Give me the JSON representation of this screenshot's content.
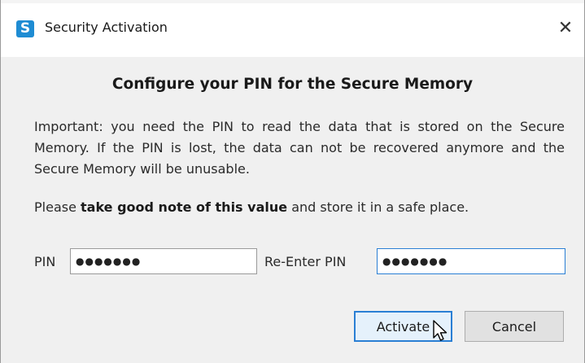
{
  "window": {
    "title": "Security Activation",
    "app_icon_letter": "S",
    "close_glyph": "✕",
    "accent_color": "#1e8cd3"
  },
  "dialog": {
    "heading": "Configure your PIN for the Secure Memory",
    "important_text": "Important: you need the PIN to read the data that is stored on the Secure Memory. If the PIN is lost, the data can not be recovered anymore and the Secure Memory will be unusable.",
    "note_prefix": "Please ",
    "note_bold": "take good note of this value",
    "note_suffix": " and store it in a safe place."
  },
  "form": {
    "pin_label": "PIN",
    "pin_value": "●●●●●●●",
    "reenter_label": "Re-Enter PIN",
    "reenter_value": "●●●●●●●"
  },
  "buttons": {
    "activate_label": "Activate",
    "cancel_label": "Cancel"
  },
  "icons": {
    "app": "app-logo-icon",
    "close": "close-icon",
    "cursor": "mouse-pointer-icon"
  }
}
